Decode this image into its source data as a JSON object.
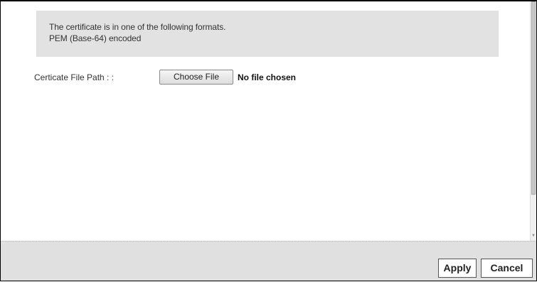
{
  "info": {
    "line1": "The certificate is in one of the following formats.",
    "line2": "PEM (Base-64) encoded"
  },
  "file_path": {
    "label": "Certicate File Path : :",
    "button_label": "Choose File",
    "status": "No file chosen"
  },
  "footer": {
    "apply_label": "Apply",
    "cancel_label": "Cancel"
  },
  "colors": {
    "info_background": "#e2e2e2",
    "footer_background": "#e0e0e0"
  }
}
